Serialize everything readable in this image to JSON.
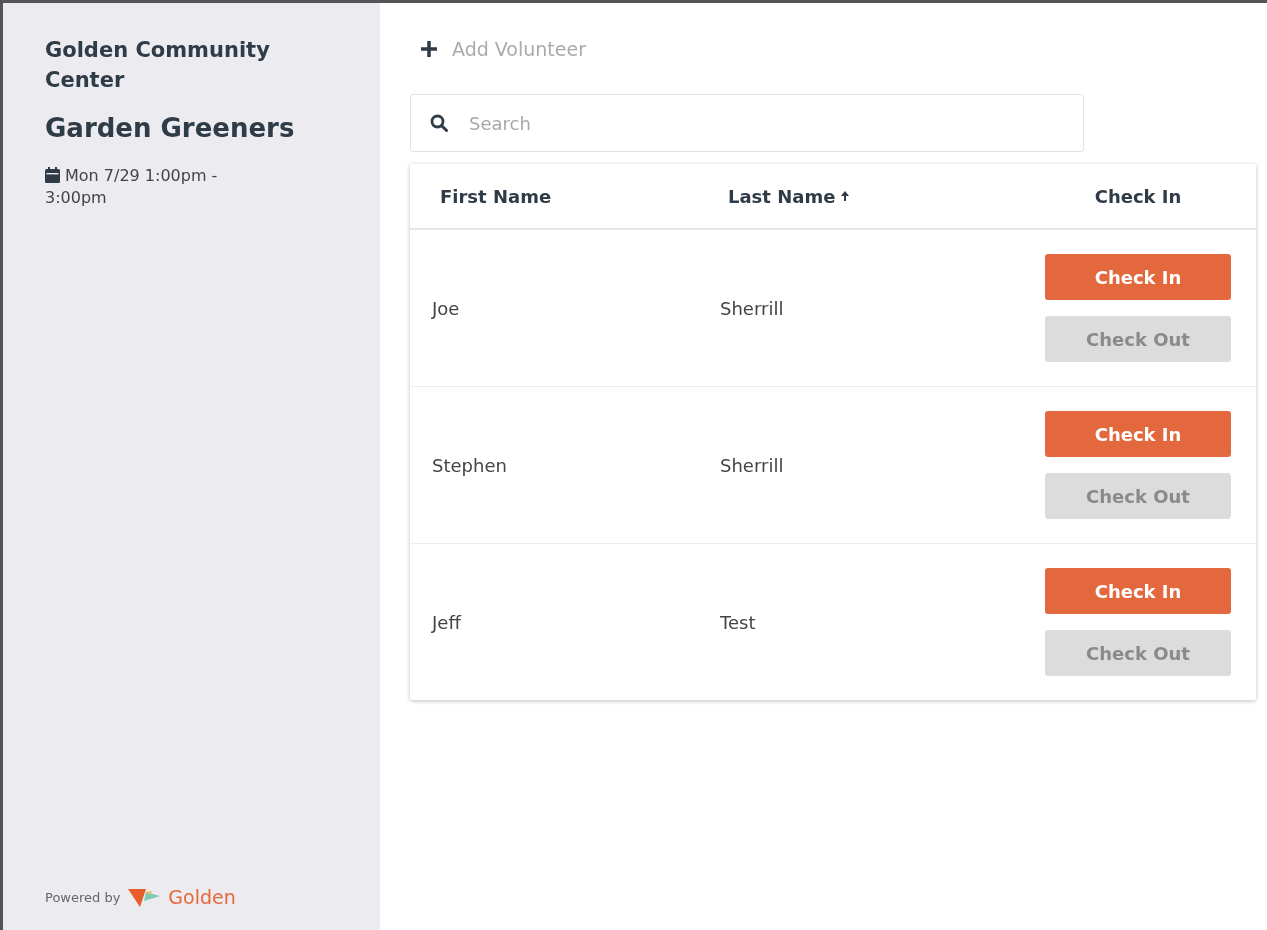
{
  "sidebar": {
    "organization": "Golden Community Center",
    "event_title": "Garden Greeners",
    "event_time": "Mon 7/29 1:00pm - 3:00pm",
    "footer": {
      "powered_by": "Powered by",
      "brand": "Golden"
    }
  },
  "add_button": {
    "label": "Add Volunteer"
  },
  "search": {
    "placeholder": "Search"
  },
  "table": {
    "columns": [
      {
        "label": "First Name",
        "sorted": false
      },
      {
        "label": "Last Name",
        "sorted": true
      },
      {
        "label": "Check In",
        "sorted": false
      }
    ],
    "rows": [
      {
        "first_name": "Joe",
        "last_name": "Sherrill",
        "check_in": {
          "label": "Check In",
          "disabled": false
        },
        "check_out": {
          "label": "Check Out",
          "disabled": true
        }
      },
      {
        "first_name": "Stephen",
        "last_name": "Sherrill",
        "check_in": {
          "label": "Check In",
          "disabled": false
        },
        "check_out": {
          "label": "Check Out",
          "disabled": true
        }
      },
      {
        "first_name": "Jeff",
        "last_name": "Test",
        "check_in": {
          "label": "Check In",
          "disabled": false
        },
        "check_out": {
          "label": "Check Out",
          "disabled": true
        }
      }
    ]
  }
}
